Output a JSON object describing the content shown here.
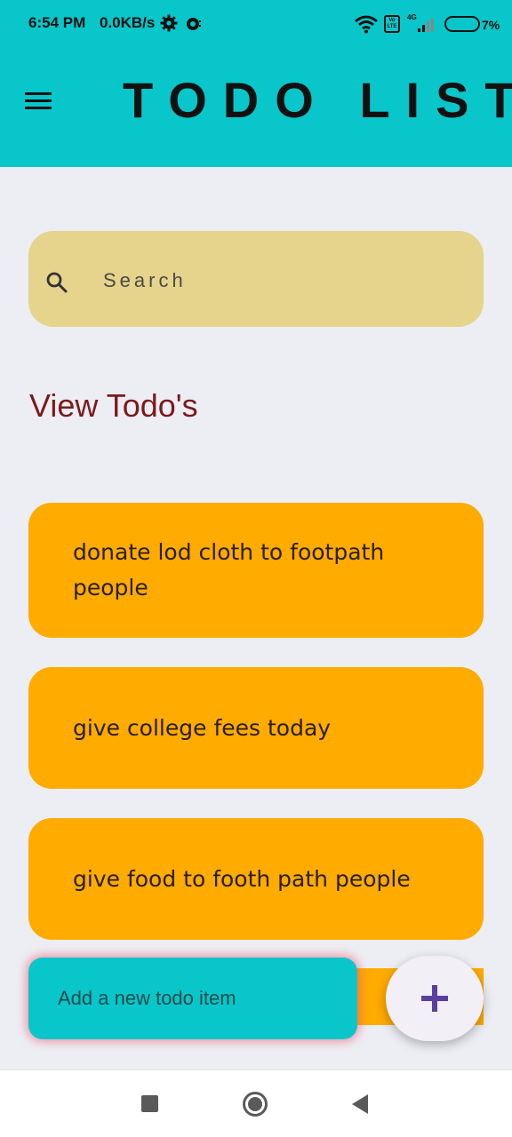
{
  "status_bar": {
    "time": "6:54 PM",
    "speed": "0.0KB/s",
    "network": "4G",
    "volte": "Vo LTE",
    "battery": "7%",
    "icons": [
      "gear-icon",
      "notification-icon",
      "wifi-icon",
      "volte-icon",
      "signal-icon",
      "battery-icon"
    ]
  },
  "app_bar": {
    "title": "TODO LIST",
    "menu_icon": "hamburger-menu-icon"
  },
  "search": {
    "placeholder": "Search",
    "icon": "search-icon"
  },
  "section": {
    "title": "View Todo's"
  },
  "todos": [
    {
      "text": "donate lod cloth to footpath people"
    },
    {
      "text": "give college fees today"
    },
    {
      "text": "give food to footh path people"
    }
  ],
  "add_item": {
    "placeholder": "Add a new todo item",
    "button_icon": "plus-icon"
  },
  "navigation_bar": {
    "icons": [
      "recent-apps-icon",
      "home-icon",
      "back-icon"
    ]
  },
  "colors": {
    "app_bar": "#08c6c9",
    "background": "#eceef3",
    "search_bg": "#e6d38c",
    "todo_bg": "#ffab00",
    "section_title": "#7b1a1d",
    "fab_plus": "#5b3fa0"
  }
}
